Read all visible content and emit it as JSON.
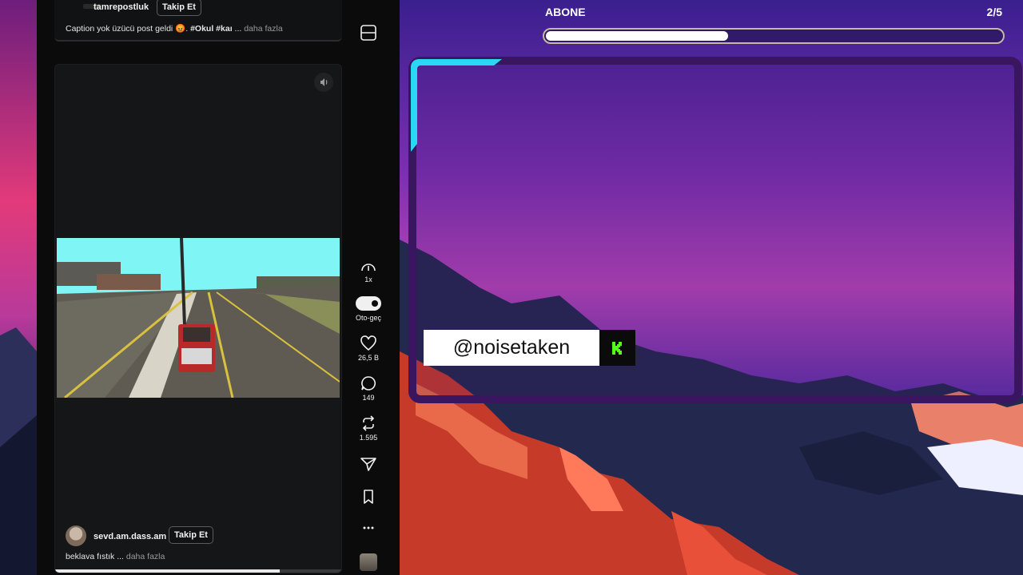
{
  "feed": {
    "top_post": {
      "username": "tamrepostluk",
      "follow_label": "Takip Et",
      "caption_text": "Caption yok üzücü post geldi 😡. ",
      "caption_hashtag": "#Okul #kaı",
      "caption_ellipsis": " ... ",
      "more_label": "daha fazla"
    },
    "video_post": {
      "username": "sevd.am.dass.am",
      "follow_label": "Takip Et",
      "caption_text": "beklava fıstık ... ",
      "more_label": "daha fazla",
      "playback_progress": 0.78
    }
  },
  "rail": {
    "speed_label": "1x",
    "autoplay_label": "Oto-geç",
    "likes": "26,5 B",
    "comments": "149",
    "reposts": "1.595",
    "icons": [
      "more-icon",
      "layout-icon",
      "speed-gauge-icon",
      "toggle-icon",
      "heart-icon",
      "comment-icon",
      "repost-icon",
      "send-icon",
      "bookmark-icon",
      "ellipsis-icon"
    ]
  },
  "overlay": {
    "goal_label": "ABONE",
    "goal_count": "2/5",
    "goal_progress": 0.4,
    "handle": "@noisetaken",
    "brand_icon": "kick-logo",
    "colors": {
      "frame_accent": "#2ad8f5",
      "frame": "#3b1660",
      "kick_green": "#53fc18"
    }
  }
}
